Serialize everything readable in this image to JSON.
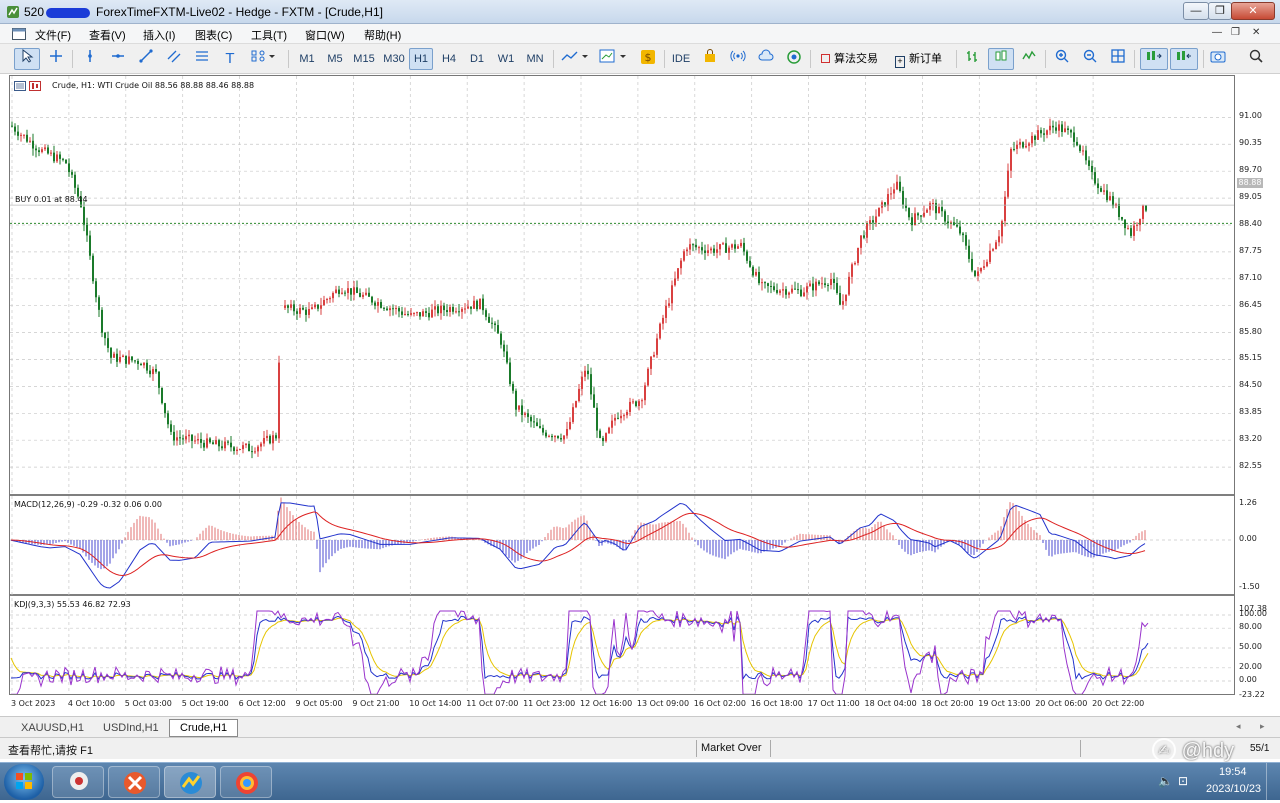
{
  "window": {
    "title_prefix": "520",
    "title": "ForexTimeFXTM-Live02 - Hedge - FXTM - [Crude,H1]",
    "min": "—",
    "max": "❐",
    "close": "✕",
    "child_min": "—",
    "child_restore": "❐",
    "child_close": "✕"
  },
  "menu": [
    "文件(F)",
    "查看(V)",
    "插入(I)",
    "图表(C)",
    "工具(T)",
    "窗口(W)",
    "帮助(H)"
  ],
  "toolbar": {
    "timeframes": [
      "M1",
      "M5",
      "M15",
      "M30",
      "H1",
      "H4",
      "D1",
      "W1",
      "MN"
    ],
    "active_timeframe": "H1",
    "ide_label": "IDE",
    "algo_label": "算法交易",
    "new_order_label": "新订单"
  },
  "chart": {
    "header": "Crude, H1:  WTI Crude Oil  88.56 88.88 88.46 88.88",
    "trade_line_label": "BUY 0.01 at 88.44",
    "current_price": "88.88",
    "trade_price": 88.44,
    "price_levels": [
      "91.00",
      "90.35",
      "89.70",
      "89.05",
      "88.40",
      "87.75",
      "87.10",
      "86.45",
      "85.80",
      "85.15",
      "84.50",
      "83.85",
      "83.20",
      "82.55"
    ],
    "macd_header": "MACD(12,26,9) -0.29 -0.32 0.06 0.00",
    "macd_levels": [
      "1.26",
      "0.00",
      "-1.50"
    ],
    "kdj_header": "KDJ(9,3,3) 55.53 46.82 72.93",
    "kdj_levels": [
      "107.38",
      "100.00",
      "80.00",
      "50.00",
      "20.00",
      "0.00",
      "-23.22"
    ],
    "time_labels": [
      "3 Oct 2023",
      "4 Oct 10:00",
      "5 Oct 03:00",
      "5 Oct 19:00",
      "6 Oct 12:00",
      "9 Oct 05:00",
      "9 Oct 21:00",
      "10 Oct 14:00",
      "11 Oct 07:00",
      "11 Oct 23:00",
      "12 Oct 16:00",
      "13 Oct 09:00",
      "16 Oct 02:00",
      "16 Oct 18:00",
      "17 Oct 11:00",
      "18 Oct 04:00",
      "18 Oct 20:00",
      "19 Oct 13:00",
      "20 Oct 06:00",
      "20 Oct 22:00"
    ],
    "colors": {
      "bull": "#d94040",
      "bear": "#1a7a2a",
      "macd_line": "#2233cc",
      "signal_line": "#dd2222",
      "k": "#2233cc",
      "d": "#e6c400",
      "j": "#9933cc",
      "trade": "#2e8b2e"
    }
  },
  "tabs": [
    "XAUUSD,H1",
    "USDInd,H1",
    "Crude,H1"
  ],
  "active_tab": "Crude,H1",
  "status": {
    "help": "查看帮忙,请按 F1",
    "profile": "Market Over",
    "right": "55/1"
  },
  "taskbar": {
    "time": "19:54",
    "date": "2023/10/23"
  },
  "watermark": "@hdy"
}
